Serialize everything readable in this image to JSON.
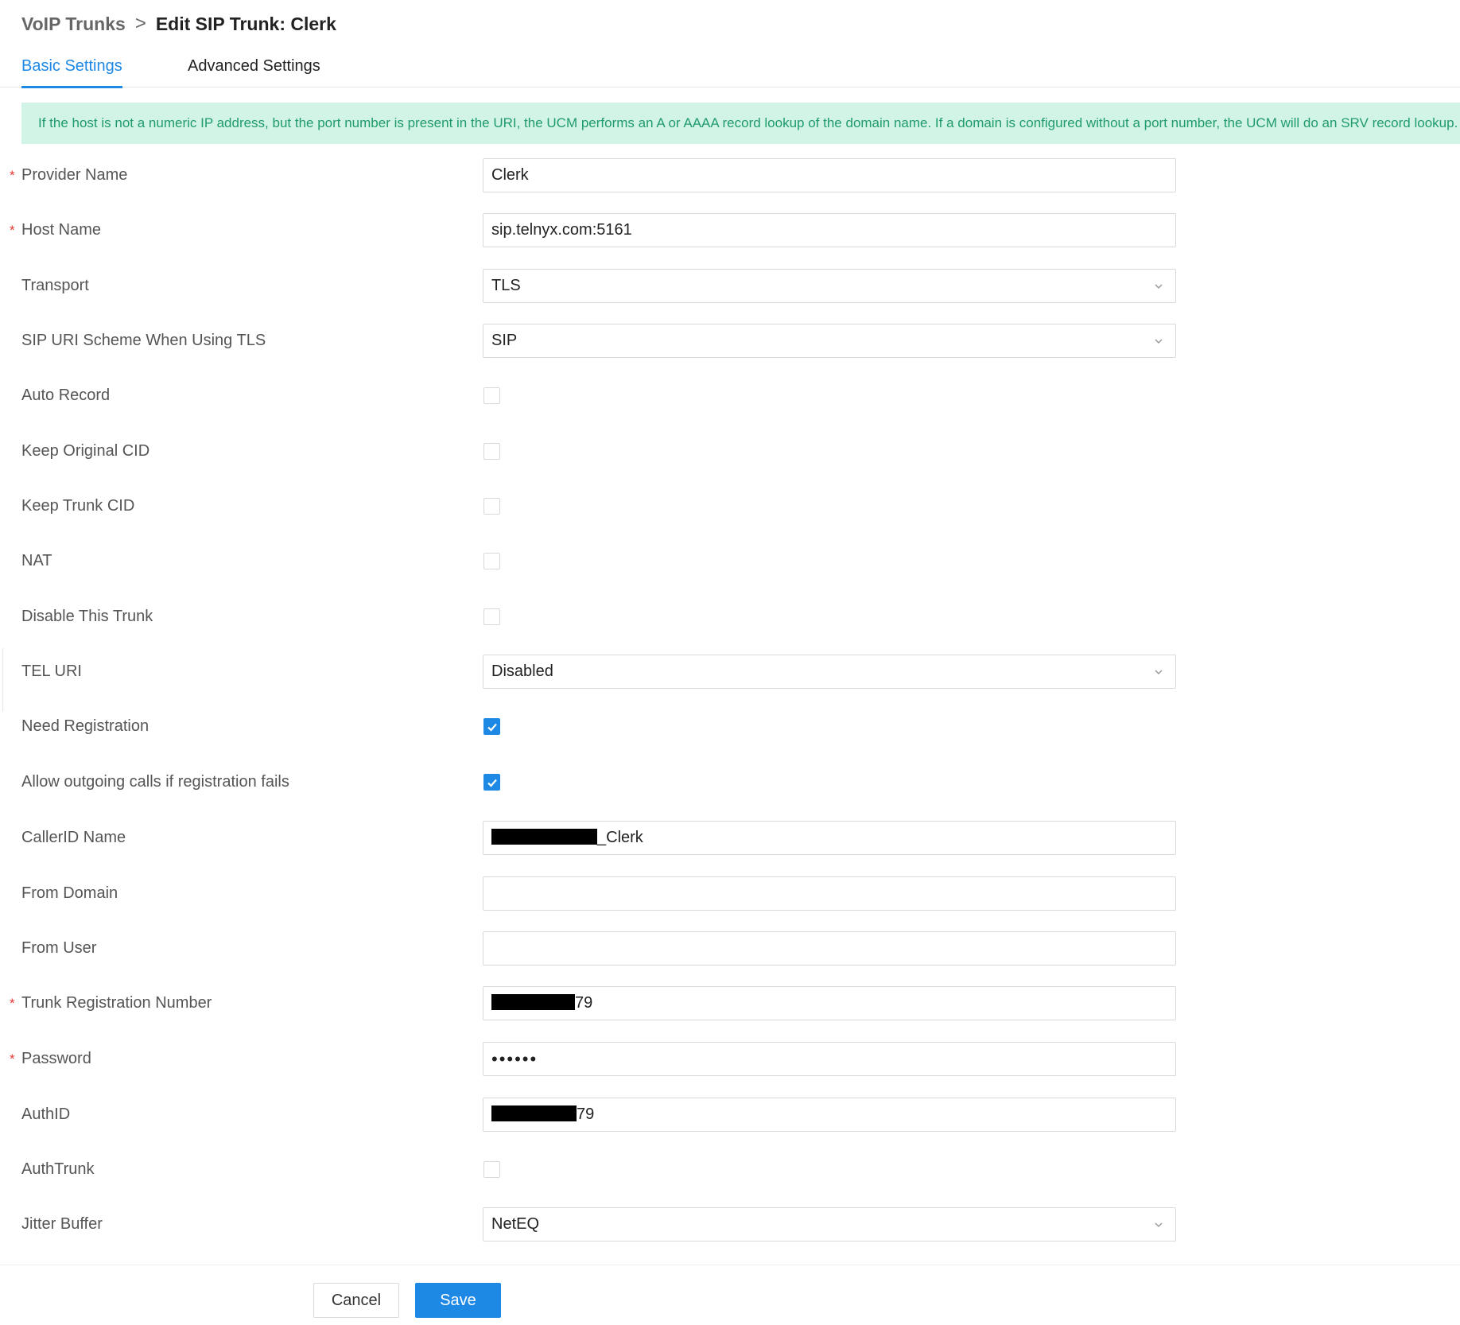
{
  "breadcrumb": {
    "parent": "VoIP Trunks",
    "separator": ">",
    "current": "Edit SIP Trunk: Clerk"
  },
  "tabs": [
    {
      "label": "Basic Settings",
      "active": true
    },
    {
      "label": "Advanced Settings",
      "active": false
    }
  ],
  "banner": {
    "text": "If the host is not a numeric IP address, but the port number is present in the URI, the UCM performs an A or AAAA record lookup of the domain name. If a domain is configured without a port number, the UCM will do an SRV record lookup."
  },
  "form": {
    "provider_name": {
      "label": "Provider Name",
      "required": true,
      "value": "Clerk"
    },
    "host_name": {
      "label": "Host Name",
      "required": true,
      "value": "sip.telnyx.com:5161"
    },
    "transport": {
      "label": "Transport",
      "value": "TLS"
    },
    "sip_uri_scheme": {
      "label": "SIP URI Scheme When Using TLS",
      "value": "SIP"
    },
    "auto_record": {
      "label": "Auto Record",
      "checked": false
    },
    "keep_original_cid": {
      "label": "Keep Original CID",
      "checked": false
    },
    "keep_trunk_cid": {
      "label": "Keep Trunk CID",
      "checked": false
    },
    "nat": {
      "label": "NAT",
      "checked": false
    },
    "disable_trunk": {
      "label": "Disable This Trunk",
      "checked": false
    },
    "tel_uri": {
      "label": "TEL URI",
      "value": "Disabled"
    },
    "need_registration": {
      "label": "Need Registration",
      "checked": true
    },
    "allow_outgoing": {
      "label": "Allow outgoing calls if registration fails",
      "checked": true
    },
    "callerid_name": {
      "label": "CallerID Name",
      "value_suffix": "_Clerk"
    },
    "from_domain": {
      "label": "From Domain",
      "value": ""
    },
    "from_user": {
      "label": "From User",
      "value": ""
    },
    "trunk_reg_number": {
      "label": "Trunk Registration Number",
      "required": true,
      "value_suffix": "79"
    },
    "password": {
      "label": "Password",
      "required": true,
      "value": "••••••"
    },
    "authid": {
      "label": "AuthID",
      "value_suffix": "79"
    },
    "authtrunk": {
      "label": "AuthTrunk",
      "checked": false
    },
    "jitter_buffer": {
      "label": "Jitter Buffer",
      "value": "NetEQ"
    }
  },
  "footer": {
    "cancel_label": "Cancel",
    "save_label": "Save"
  },
  "colors": {
    "accent": "#1e88e5",
    "banner_bg": "#d2f4e6",
    "banner_text": "#1f9b6c",
    "required": "#e53935"
  }
}
